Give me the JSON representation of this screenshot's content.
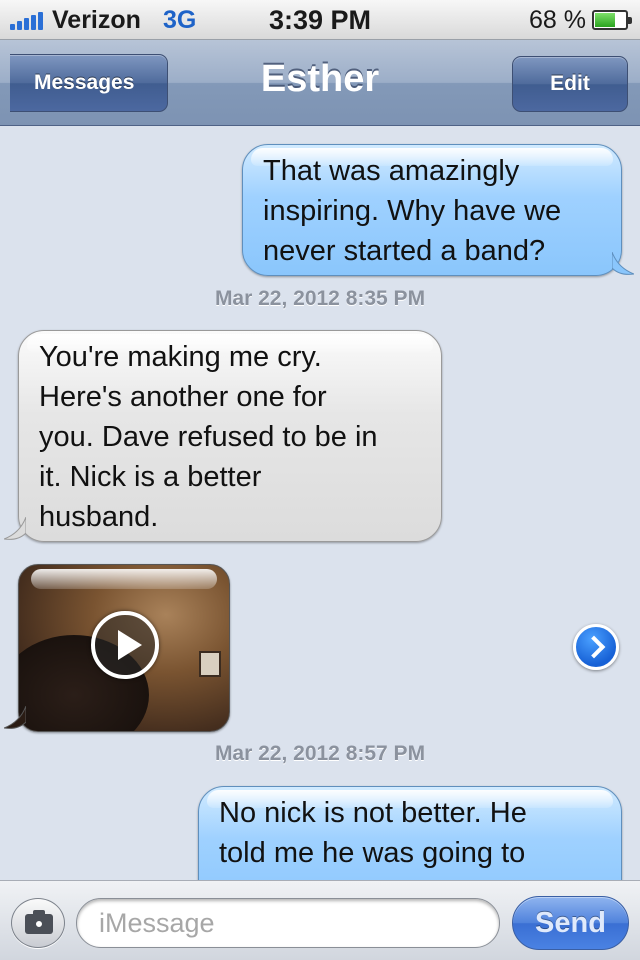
{
  "status_bar": {
    "carrier": "Verizon",
    "network": "3G",
    "time": "3:39 PM",
    "battery_percent": "68 %",
    "battery_level": 0.68,
    "signal_icon": "signal-bars-icon",
    "battery_icon": "battery-icon"
  },
  "nav": {
    "back_label": "Messages",
    "title": "Esther",
    "edit_label": "Edit"
  },
  "thread": {
    "messages": [
      {
        "type": "sent",
        "text": "That was amazingly\ninspiring. Why have we\nnever started a band?"
      },
      {
        "type": "timestamp",
        "text": "Mar 22, 2012 8:35 PM"
      },
      {
        "type": "received",
        "text": "You're making me cry.\nHere's another one for\nyou. Dave refused to be in\nit. Nick is a better\nhusband."
      },
      {
        "type": "received_video",
        "icon": "play-icon",
        "disclosure_icon": "chevron-right-circle-icon"
      },
      {
        "type": "timestamp",
        "text": "Mar 22, 2012 8:57 PM"
      },
      {
        "type": "sent",
        "text": "No nick is not better. He\ntold me he was going to"
      }
    ]
  },
  "input_bar": {
    "camera_icon": "camera-icon",
    "placeholder": "iMessage",
    "send_label": "Send"
  },
  "colors": {
    "background": "#dbe2ed",
    "sent_bubble": "#9fd1ff",
    "received_bubble": "#e6e6e6",
    "nav_bar": "#8399b8",
    "send_button": "#4f82dc",
    "timestamp_text": "#8b929e"
  }
}
